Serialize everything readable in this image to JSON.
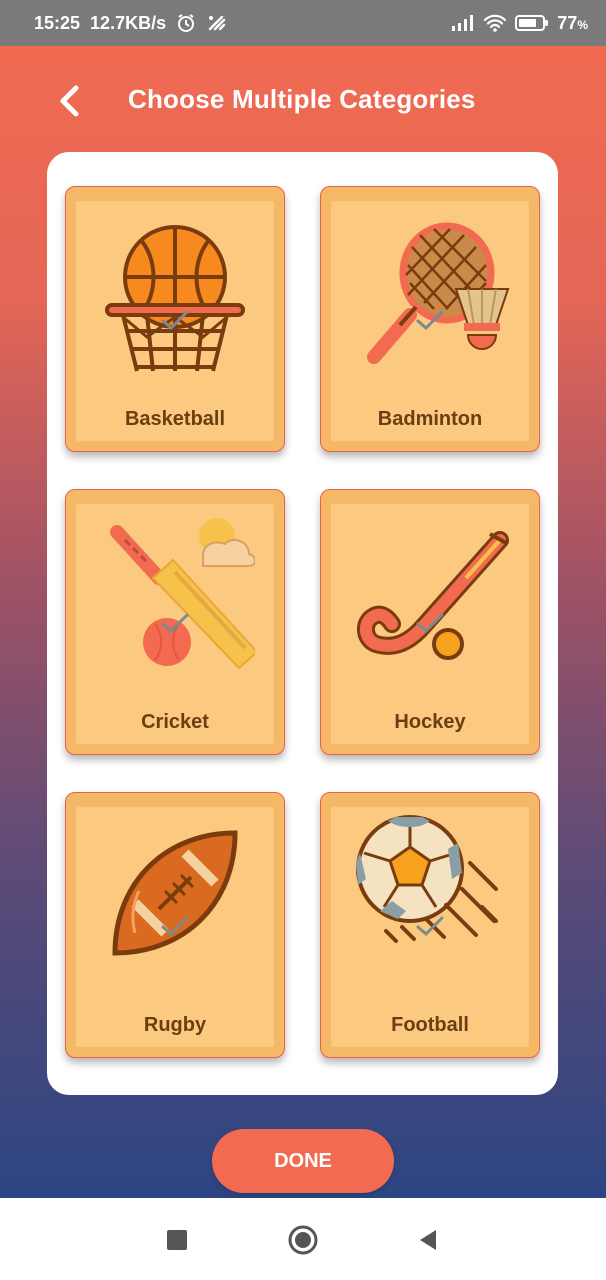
{
  "status_bar": {
    "time": "15:25",
    "net_speed": "12.7KB/s",
    "battery": "77",
    "battery_unit": "%",
    "icons": [
      "alarm-icon",
      "data-saver-icon",
      "signal-icon",
      "wifi-icon",
      "battery-icon"
    ]
  },
  "header": {
    "back_icon": "chevron-left-icon",
    "title": "Choose Multiple Categories"
  },
  "categories": [
    {
      "label": "Basketball",
      "icon": "basketball-icon",
      "checked": true
    },
    {
      "label": "Badminton",
      "icon": "badminton-icon",
      "checked": true
    },
    {
      "label": "Cricket",
      "icon": "cricket-icon",
      "checked": true
    },
    {
      "label": "Hockey",
      "icon": "hockey-icon",
      "checked": true
    },
    {
      "label": "Rugby",
      "icon": "rugby-icon",
      "checked": true
    },
    {
      "label": "Football",
      "icon": "football-icon",
      "checked": true
    }
  ],
  "done_button": {
    "label": "DONE"
  },
  "nav_bar": {
    "icons": [
      "recents-icon",
      "home-icon",
      "back-icon"
    ]
  },
  "colors": {
    "accent": "#f26b50",
    "tile_fill": "#fcc980",
    "tile_border": "#e8624a",
    "label_text": "#6b3e12",
    "gradient_top": "#f26b50",
    "gradient_bottom": "#2c4582"
  }
}
